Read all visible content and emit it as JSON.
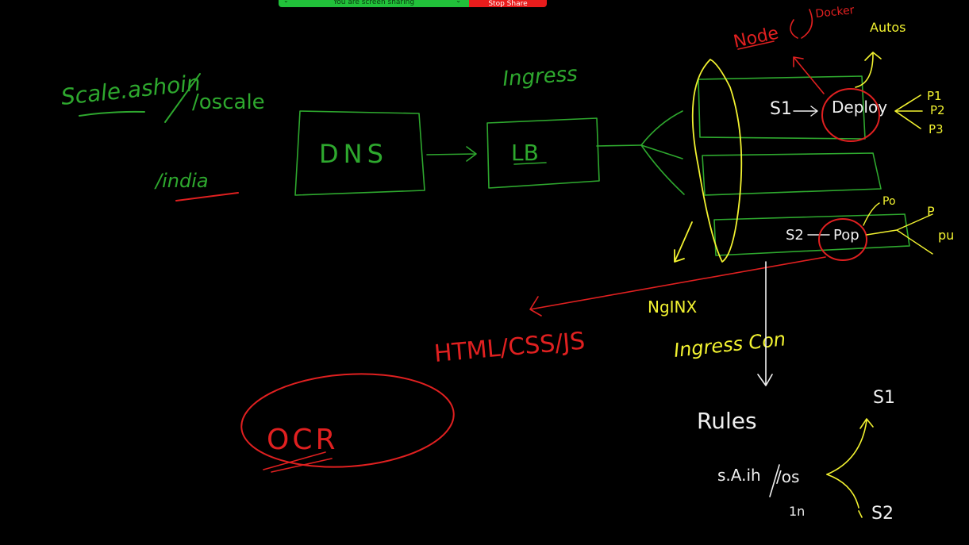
{
  "app": {
    "share_status": "You are screen sharing",
    "stop_share_label": "Stop Share"
  },
  "colors": {
    "background": "#000000",
    "green": "#2ea82e",
    "yellow": "#f2f230",
    "red": "#e02020",
    "white": "#f0f0f0",
    "share_green": "#21c13a",
    "share_red": "#e81c1c"
  },
  "whiteboard": {
    "labels": {
      "scale": "Scale.ashoin",
      "scale_india": "/india",
      "oscale": "/oscale",
      "dns": "DNS",
      "ingress": "Ingress",
      "lb": "LB",
      "node": "Node",
      "docker": "Docker",
      "autos": "Autos",
      "s1": "S1",
      "deploy": "Deploy",
      "p1": "P1",
      "p2": "P2",
      "p3": "P3",
      "s2": "S2",
      "pop": "Pop",
      "po": "Po",
      "p": "P",
      "pu": "pu",
      "nginx": "NgINX",
      "ingress_con": "Ingress Con",
      "html": "HTML/CSS/JS",
      "ocr": "OCR",
      "rules": "Rules",
      "rule_host": "s.A.ih",
      "rule_path": "/os",
      "rule_1n": "1n",
      "rule_s1": "S1",
      "rule_s2": "S2"
    }
  }
}
